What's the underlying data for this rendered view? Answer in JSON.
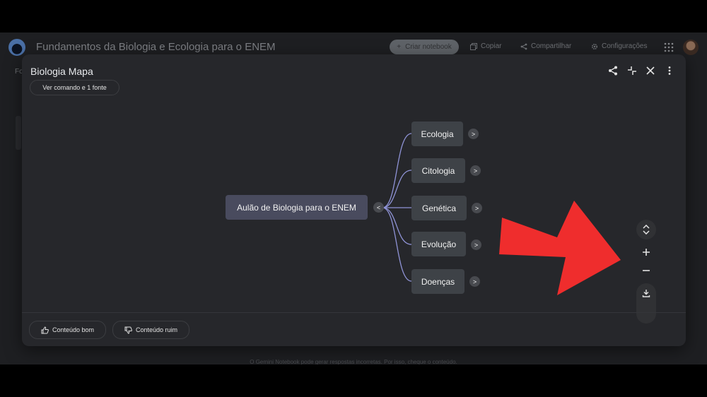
{
  "app": {
    "notebook_title": "Fundamentos da Biologia e Ecologia para o ENEM",
    "create_notebook": "Criar notebook",
    "copy": "Copiar",
    "share": "Compartilhar",
    "settings": "Configurações",
    "behind_tab": "Fo",
    "footer_disclaimer": "O Gemini Notebook pode gerar respostas incorretas. Por isso, cheque o conteúdo."
  },
  "modal": {
    "title": "Biologia Mapa",
    "source_chip": "Ver comando e 1 fonte"
  },
  "mindmap": {
    "root": {
      "label": "Aulão de Biologia para o ENEM",
      "expander": "<"
    },
    "children": [
      {
        "label": "Ecologia",
        "expander": ">"
      },
      {
        "label": "Citologia",
        "expander": ">"
      },
      {
        "label": "Genética",
        "expander": ">"
      },
      {
        "label": "Evolução",
        "expander": ">"
      },
      {
        "label": "Doenças",
        "expander": ">"
      }
    ]
  },
  "feedback": {
    "good": "Conteúdo bom",
    "bad": "Conteúdo ruim"
  },
  "colors": {
    "accent_arrow": "#ef2d2d",
    "edge": "#8f93d6",
    "root_node": "#494b5e",
    "child_node": "#3e4247"
  }
}
